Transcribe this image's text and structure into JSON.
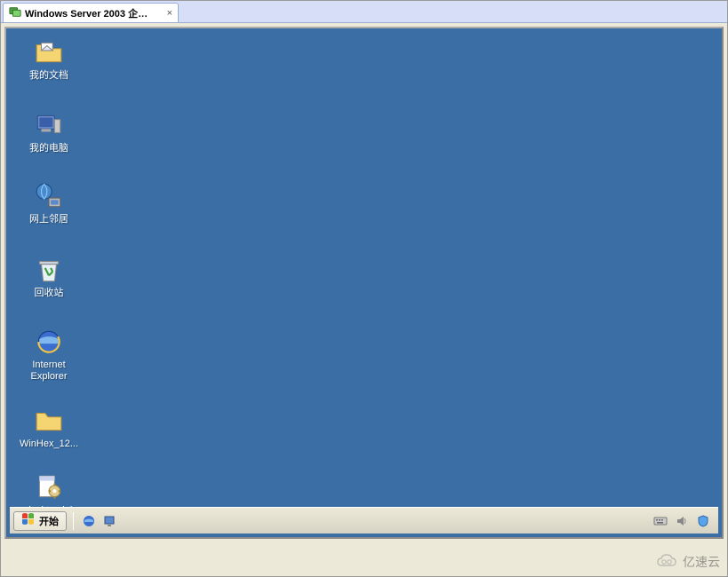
{
  "tab": {
    "title": "Windows Server 2003 企…",
    "close": "×"
  },
  "desktop_icons": [
    {
      "key": "mydocs",
      "label": "我的文档"
    },
    {
      "key": "mycomp",
      "label": "我的电脑"
    },
    {
      "key": "network",
      "label": "网上邻居"
    },
    {
      "key": "recycle",
      "label": "回收站"
    },
    {
      "key": "ie",
      "label": "Internet\nExplorer"
    },
    {
      "key": "winhex",
      "label": "WinHex_12..."
    },
    {
      "key": "deskini",
      "label": "desktop.ini"
    }
  ],
  "taskbar": {
    "start": "开始"
  },
  "watermark": "亿速云"
}
